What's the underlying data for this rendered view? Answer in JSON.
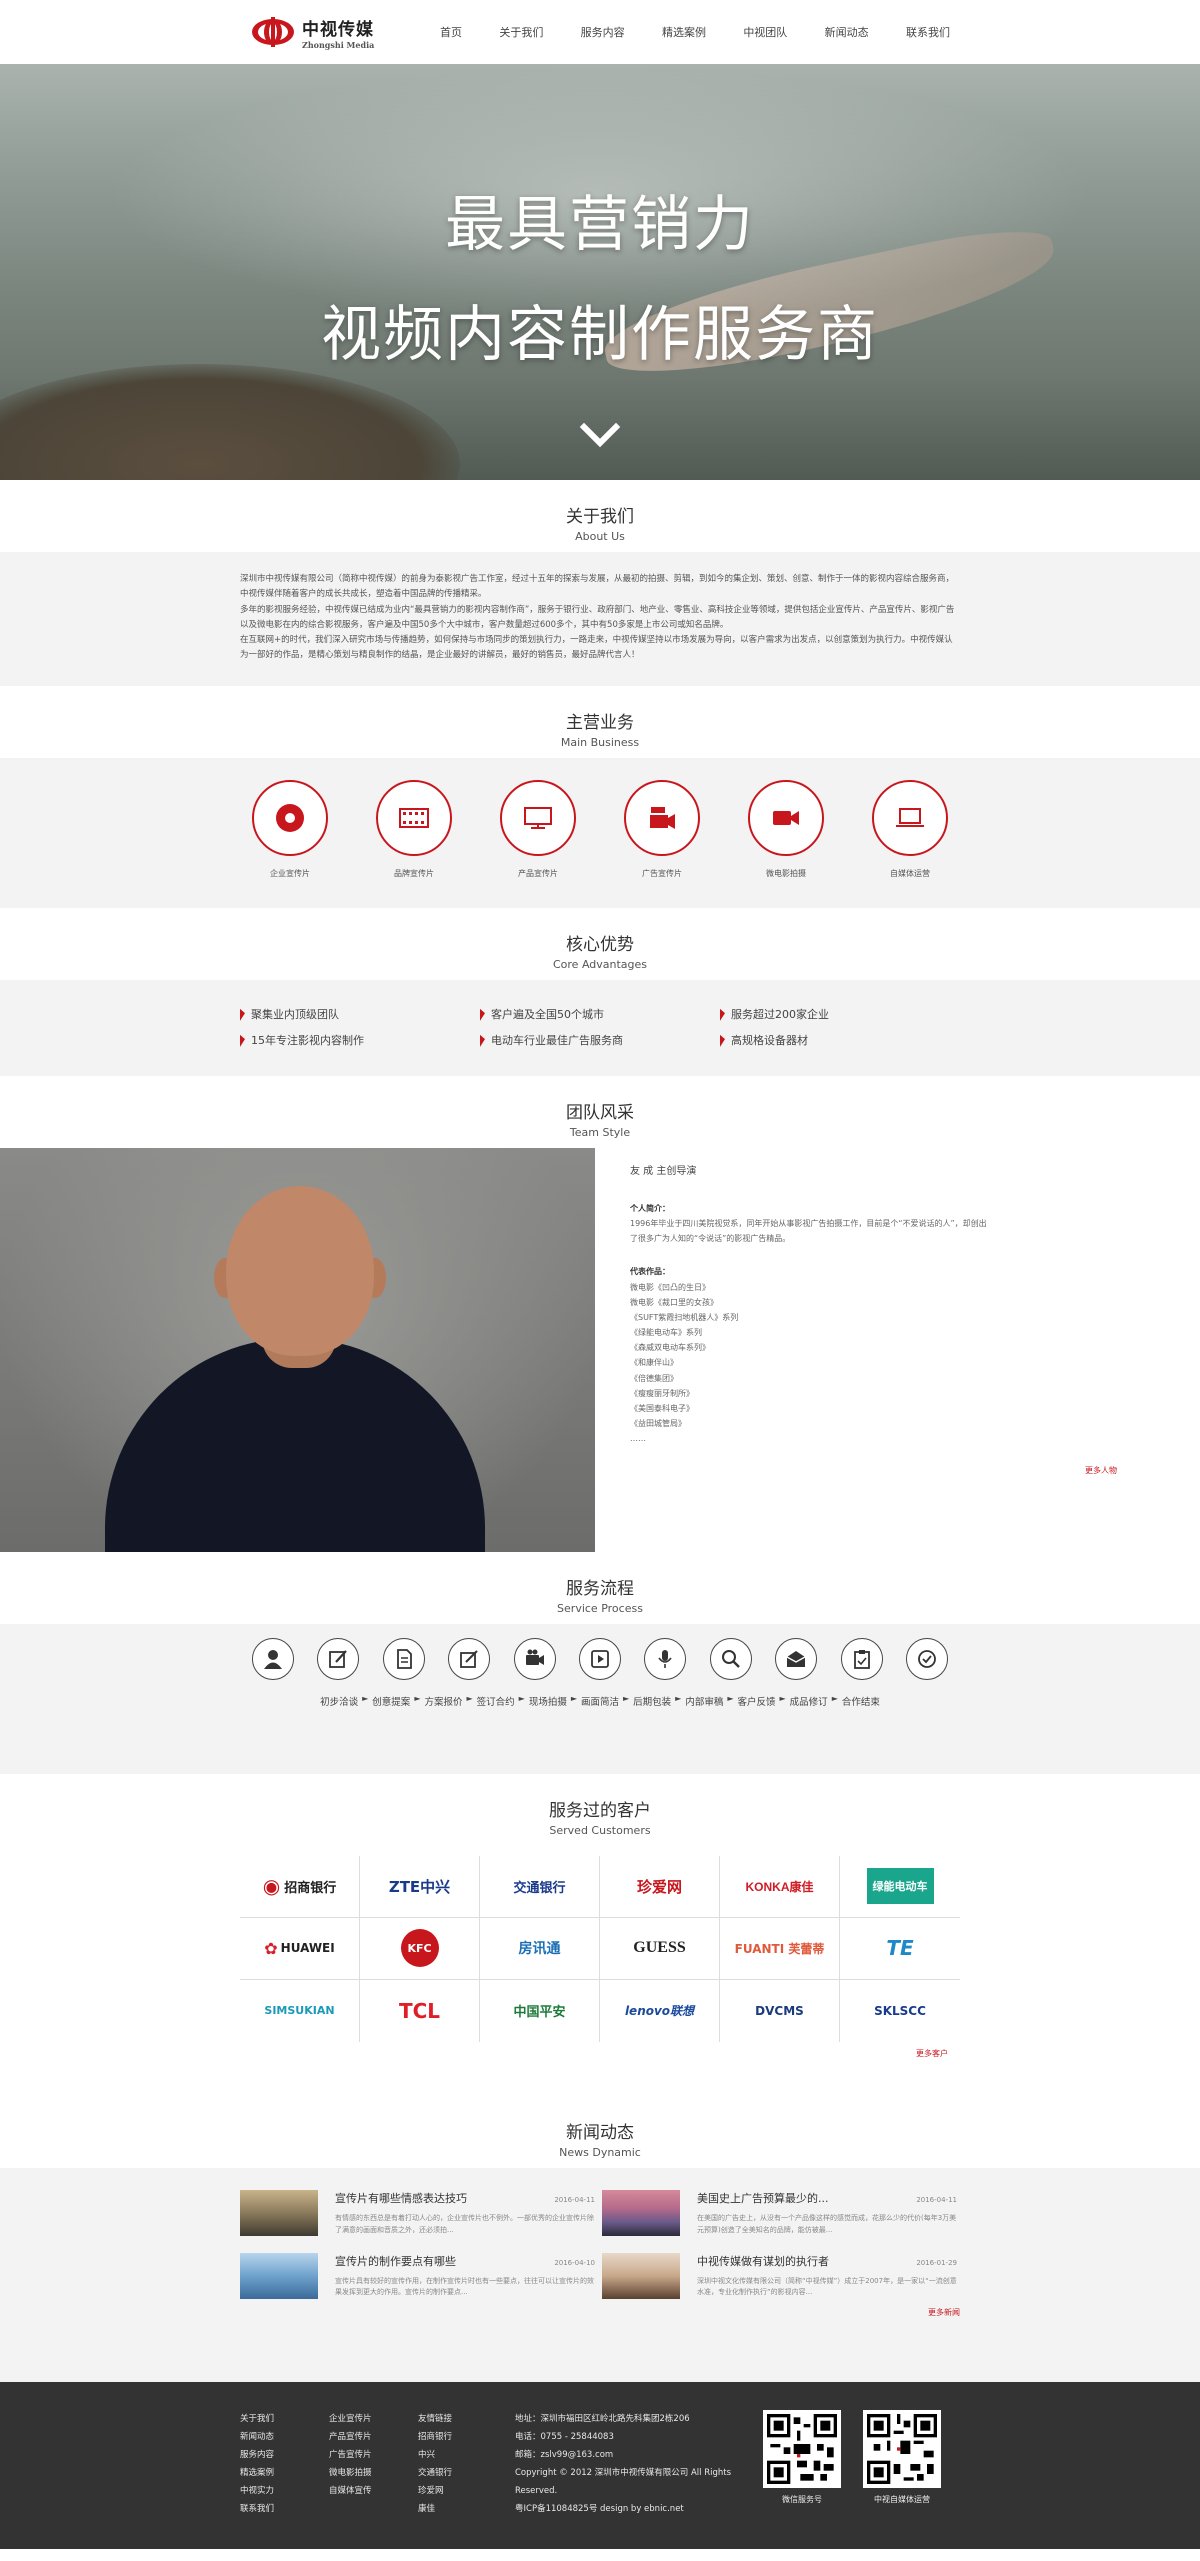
{
  "header": {
    "logo_cn": "中视传媒",
    "logo_en": "Zhongshi Media",
    "nav": [
      "首页",
      "关于我们",
      "服务内容",
      "精选案例",
      "中视团队",
      "新闻动态",
      "联系我们"
    ]
  },
  "banner": {
    "line1": "最具营销力",
    "line2": "视频内容制作服务商"
  },
  "about": {
    "title_cn": "关于我们",
    "title_en": "About Us",
    "paragraphs": [
      "深圳市中视传媒有限公司（简称中视传媒）的前身为泰影视广告工作室，经过十五年的探索与发展，从最初的拍摄、剪辑，到如今的集企划、策划、创意、制作于一体的影视内容综合服务商，中视传媒伴随着客户的成长共成长，塑造着中国品牌的传播精采。",
      "多年的影视服务经验，中视传媒已结成为业内“最具营销力的影视内容制作商”，服务于银行业、政府部门、地产业、零售业、高科技企业等领域，提供包括企业宣传片、产品宣传片、影视广告以及微电影在内的综合影视服务，客户遍及中国50多个大中城市，客户数量超过600多个，其中有50多家是上市公司或知名品牌。",
      "在互联网+的时代，我们深入研究市场与传播趋势，如何保持与市场同步的策划执行力，一路走来，中视传媒坚持以市场发展为导向，以客户需求为出发点，以创意策划为执行力。中视传媒认为一部好的作品，是精心策划与精良制作的结晶，是企业最好的讲解员，最好的销售员，最好品牌代言人！"
    ]
  },
  "business": {
    "title_cn": "主营业务",
    "title_en": "Main Business",
    "items": [
      "企业宣传片",
      "品牌宣传片",
      "产品宣传片",
      "广告宣传片",
      "微电影拍摄",
      "自媒体运营"
    ]
  },
  "advantages": {
    "title_cn": "核心优势",
    "title_en": "Core Advantages",
    "items": [
      "聚集业内顶级团队",
      "客户遍及全国50个城市",
      "服务超过200家企业",
      "15年专注影视内容制作",
      "电动车行业最佳广告服务商",
      "高规格设备器材"
    ]
  },
  "team": {
    "title_cn": "团队风采",
    "title_en": "Team Style",
    "name": "友 成  主创导演",
    "intro_title": "个人简介：",
    "intro": "1996年毕业于四川美院视觉系，同年开始从事影视广告拍摄工作，目前是个“不爱说话的人”，却创出了很多广为人知的“令说话”的影视广告精品。",
    "works_title": "代表作品：",
    "works": [
      "微电影《凹凸的生日》",
      "微电影《裁口里的女孩》",
      "《SUFT紫霞扫地机器人》系列",
      "《绿能电动车》系列",
      "《森威双电动车系列》",
      "《和康伴山》",
      "《倍德集团》",
      "《瘦瘦丽牙制所》",
      "《美国泰科电子》",
      "《益田城管局》",
      "……"
    ],
    "more": "更多人物"
  },
  "process": {
    "title_cn": "服务流程",
    "title_en": "Service Process",
    "steps": [
      "初步洽谈",
      "创意提案",
      "方案报价",
      "签订合约",
      "现场拍摄",
      "画面简洁",
      "后期包装",
      "内部审稿",
      "客户反馈",
      "成品修订",
      "合作结束"
    ]
  },
  "customers": {
    "title_cn": "服务过的客户",
    "title_en": "Served Customers",
    "logos": [
      "招商银行",
      "ZTE中兴",
      "交通银行",
      "珍爱网",
      "KONKA康佳",
      "绿能电动车",
      "HUAWEI",
      "KFC",
      "房讯通",
      "GUESS",
      "FUANTI 芙蕾蒂",
      "TE",
      "SIMSUKIAN",
      "TCL",
      "中国平安",
      "lenovo联想",
      "DVCMS",
      "SKLSCC"
    ],
    "more": "更多客户"
  },
  "news": {
    "title_cn": "新闻动态",
    "title_en": "News Dynamic",
    "items": [
      {
        "title": "宣传片有哪些情感表达技巧",
        "date": "2016-04-11",
        "desc": "有情感的东西总是有着打动人心的，企业宣传片也不例外。一部优秀的企业宣传片除了满意的画面和音质之外，还必须拍..."
      },
      {
        "title": "美国史上广告预算最少的...",
        "date": "2016-04-11",
        "desc": "在美国的广告史上，从没有一个产品像这样的感觉而成，花那么少的代价(每年3万美元预算)创造了全美知名的品牌，能仿被最..."
      },
      {
        "title": "宣传片的制作要点有哪些",
        "date": "2016-04-10",
        "desc": "宣传片具有较好的宣传作用，在制作宣传片时也有一些要点，往往可以让宣传片的效果发挥到更大的作用。宣传片的制作要点..."
      },
      {
        "title": "中视传媒做有谋划的执行者",
        "date": "2016-01-29",
        "desc": "深圳中视文化传媒有限公司（简称“中视传媒”）成立于2007年，是一家以“一流创意水准，专业化制作执行”的影视内容..."
      }
    ],
    "more": "更多新闻"
  },
  "footer": {
    "col1": [
      "关于我们",
      "新闻动态",
      "服务内容",
      "精选案例",
      "中视实力",
      "联系我们"
    ],
    "col2": [
      "企业宣传片",
      "产品宣传片",
      "广告宣传片",
      "微电影拍摄",
      "自媒体宣传"
    ],
    "col3": [
      "友情链接",
      "招商银行",
      "中兴",
      "交通银行",
      "珍爱网",
      "康佳"
    ],
    "address": "地址：深圳市福田区红岭北路先科集团2栋206",
    "phone": "电话：0755 - 25844083",
    "email": "邮箱：zslv99@163.com",
    "copyright": "Copyright © 2012 深圳市中视传媒有限公司 All Rights Reserved.",
    "icp": "粤ICP备11084825号 design by ebnic.net",
    "qr1": "微信服务号",
    "qr2": "中视自媒体运营"
  },
  "colors": {
    "accent": "#c8161d",
    "footer_bg": "#333333",
    "section_bg": "#f3f3f3"
  }
}
